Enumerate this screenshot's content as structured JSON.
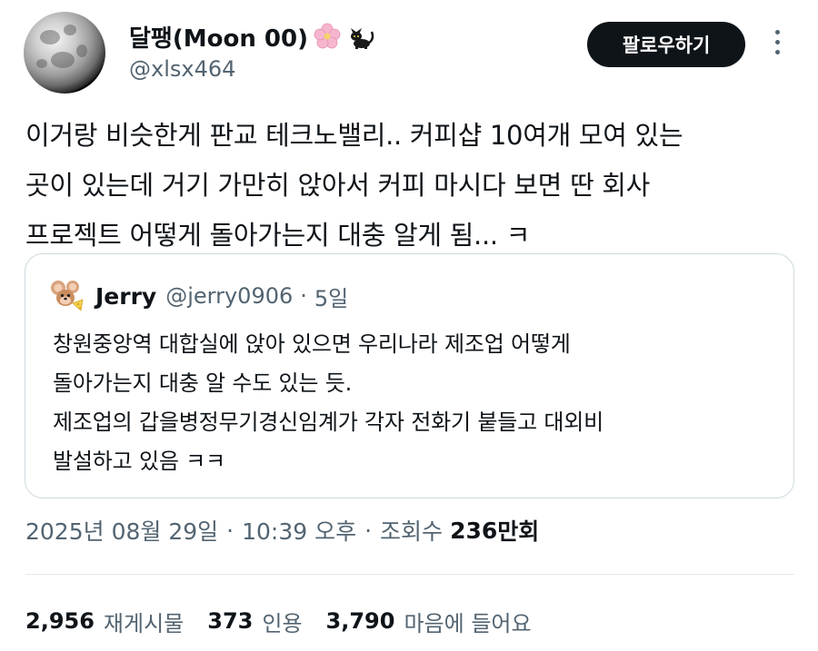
{
  "author": {
    "display_name": "달팽(Moon 00)",
    "emoji_1": "cherry-blossom",
    "emoji_2": "black-cat",
    "handle": "@xlsx464",
    "follow_label": "팔로우하기"
  },
  "tweet": {
    "text": "이거랑 비슷한게 판교 테크노밸리.. 커피샵 10여개 모여 있는\n곳이 있는데 거기 가만히 앉아서 커피 마시다 보면 딴 회사\n프로젝트 어떻게 돌아가는지 대충 알게 됨... ㅋ"
  },
  "quote": {
    "name": "Jerry",
    "handle": "@jerry0906",
    "separator": "·",
    "time": "5일",
    "text": "창원중앙역 대합실에 앉아 있으면 우리나라 제조업 어떻게\n돌아가는지 대충 알 수도 있는 듯.\n제조업의 갑을병정무기경신임계가 각자 전화기 붙들고 대외비\n발설하고 있음 ㅋㅋ"
  },
  "meta": {
    "date": "2025년 08월 29일",
    "sep1": "·",
    "time": "10:39 오후",
    "sep2": "·",
    "views_label": "조회수",
    "views_num": "236",
    "views_unit": "만회"
  },
  "stats": {
    "retweets_num": "2,956",
    "retweets_label": "재게시물",
    "quotes_num": "373",
    "quotes_label": "인용",
    "likes_num": "3,790",
    "likes_label": "마음에 들어요"
  },
  "colors": {
    "text": "#0f1419",
    "muted": "#536471",
    "border": "#cfd9de",
    "follow_bg": "#0f1419"
  }
}
